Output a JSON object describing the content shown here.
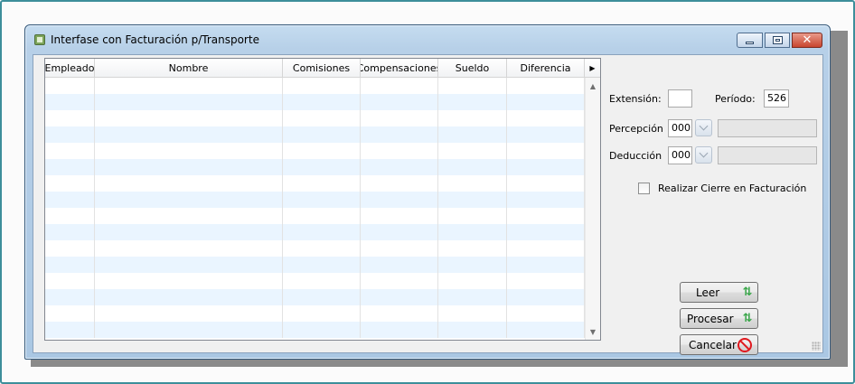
{
  "window": {
    "title": "Interfase con Facturación p/Transporte"
  },
  "grid": {
    "columns": [
      "Empleado",
      "Nombre",
      "Comisiones",
      "Compensaciones",
      "Sueldo",
      "Diferencia"
    ],
    "rows": []
  },
  "form": {
    "extension_label": "Extensión:",
    "extension_value": "",
    "periodo_label": "Período:",
    "periodo_value": "526",
    "percepcion_label": "Percepción",
    "percepcion_code": "000",
    "percepcion_desc": "",
    "deduccion_label": "Deducción",
    "deduccion_code": "000",
    "deduccion_desc": "",
    "cierre_label": "Realizar Cierre en Facturación",
    "cierre_checked": false
  },
  "buttons": {
    "leer": "Leer",
    "procesar": "Procesar",
    "cancelar": "Cancelar"
  },
  "icons": {
    "title": "form-icon",
    "leer": "refresh-icon",
    "procesar": "refresh-icon",
    "cancelar": "cancel-icon"
  },
  "colors": {
    "grid_alt_row": "#eaf5ff",
    "close_button": "#c8452f",
    "refresh_icon": "#3aa64a",
    "cancel_icon": "#e0191f"
  }
}
